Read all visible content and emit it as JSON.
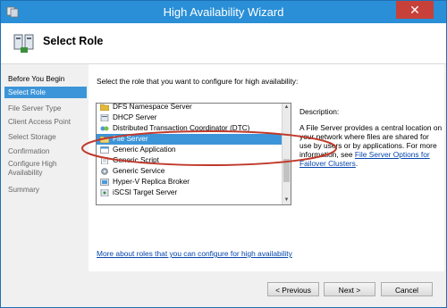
{
  "window": {
    "title": "High Availability Wizard",
    "close_glyph": "✕"
  },
  "header": {
    "title": "Select Role",
    "icon": "cluster-icon"
  },
  "steps": [
    {
      "label": "Before You Begin",
      "state": "done"
    },
    {
      "label": "Select Role",
      "state": "active"
    },
    {
      "label": "File Server Type",
      "state": "pending"
    },
    {
      "label": "Client Access Point",
      "state": "pending"
    },
    {
      "label": "Select Storage",
      "state": "pending"
    },
    {
      "label": "Confirmation",
      "state": "pending"
    },
    {
      "label": "Configure High Availability",
      "state": "pending"
    },
    {
      "label": "Summary",
      "state": "pending"
    }
  ],
  "main": {
    "prompt": "Select the role that you want to configure for high availability:",
    "roles": [
      {
        "label": "DFS Namespace Server",
        "icon": "dfs-icon",
        "selected": false
      },
      {
        "label": "DHCP Server",
        "icon": "dhcp-icon",
        "selected": false
      },
      {
        "label": "Distributed Transaction Coordinator (DTC)",
        "icon": "dtc-icon",
        "selected": false
      },
      {
        "label": "File Server",
        "icon": "file-server-icon",
        "selected": true
      },
      {
        "label": "Generic Application",
        "icon": "generic-application-icon",
        "selected": false
      },
      {
        "label": "Generic Script",
        "icon": "generic-script-icon",
        "selected": false
      },
      {
        "label": "Generic Service",
        "icon": "generic-service-icon",
        "selected": false
      },
      {
        "label": "Hyper-V Replica Broker",
        "icon": "hyperv-replica-icon",
        "selected": false
      },
      {
        "label": "iSCSI Target Server",
        "icon": "iscsi-icon",
        "selected": false
      }
    ],
    "description_label": "Description:",
    "description_text": "A File Server provides a central location on your network where files are shared for use by users or by applications. For more information, see ",
    "description_link": "File Server Options for Failover Clusters",
    "description_end": ".",
    "more_link": "More about roles that you can configure for high availability"
  },
  "buttons": {
    "previous": "< Previous",
    "next": "Next >",
    "cancel": "Cancel"
  },
  "colors": {
    "titlebar": "#2a8fd6",
    "selection": "#3d95d9",
    "link": "#0645ad",
    "annotation": "#c0392b"
  }
}
